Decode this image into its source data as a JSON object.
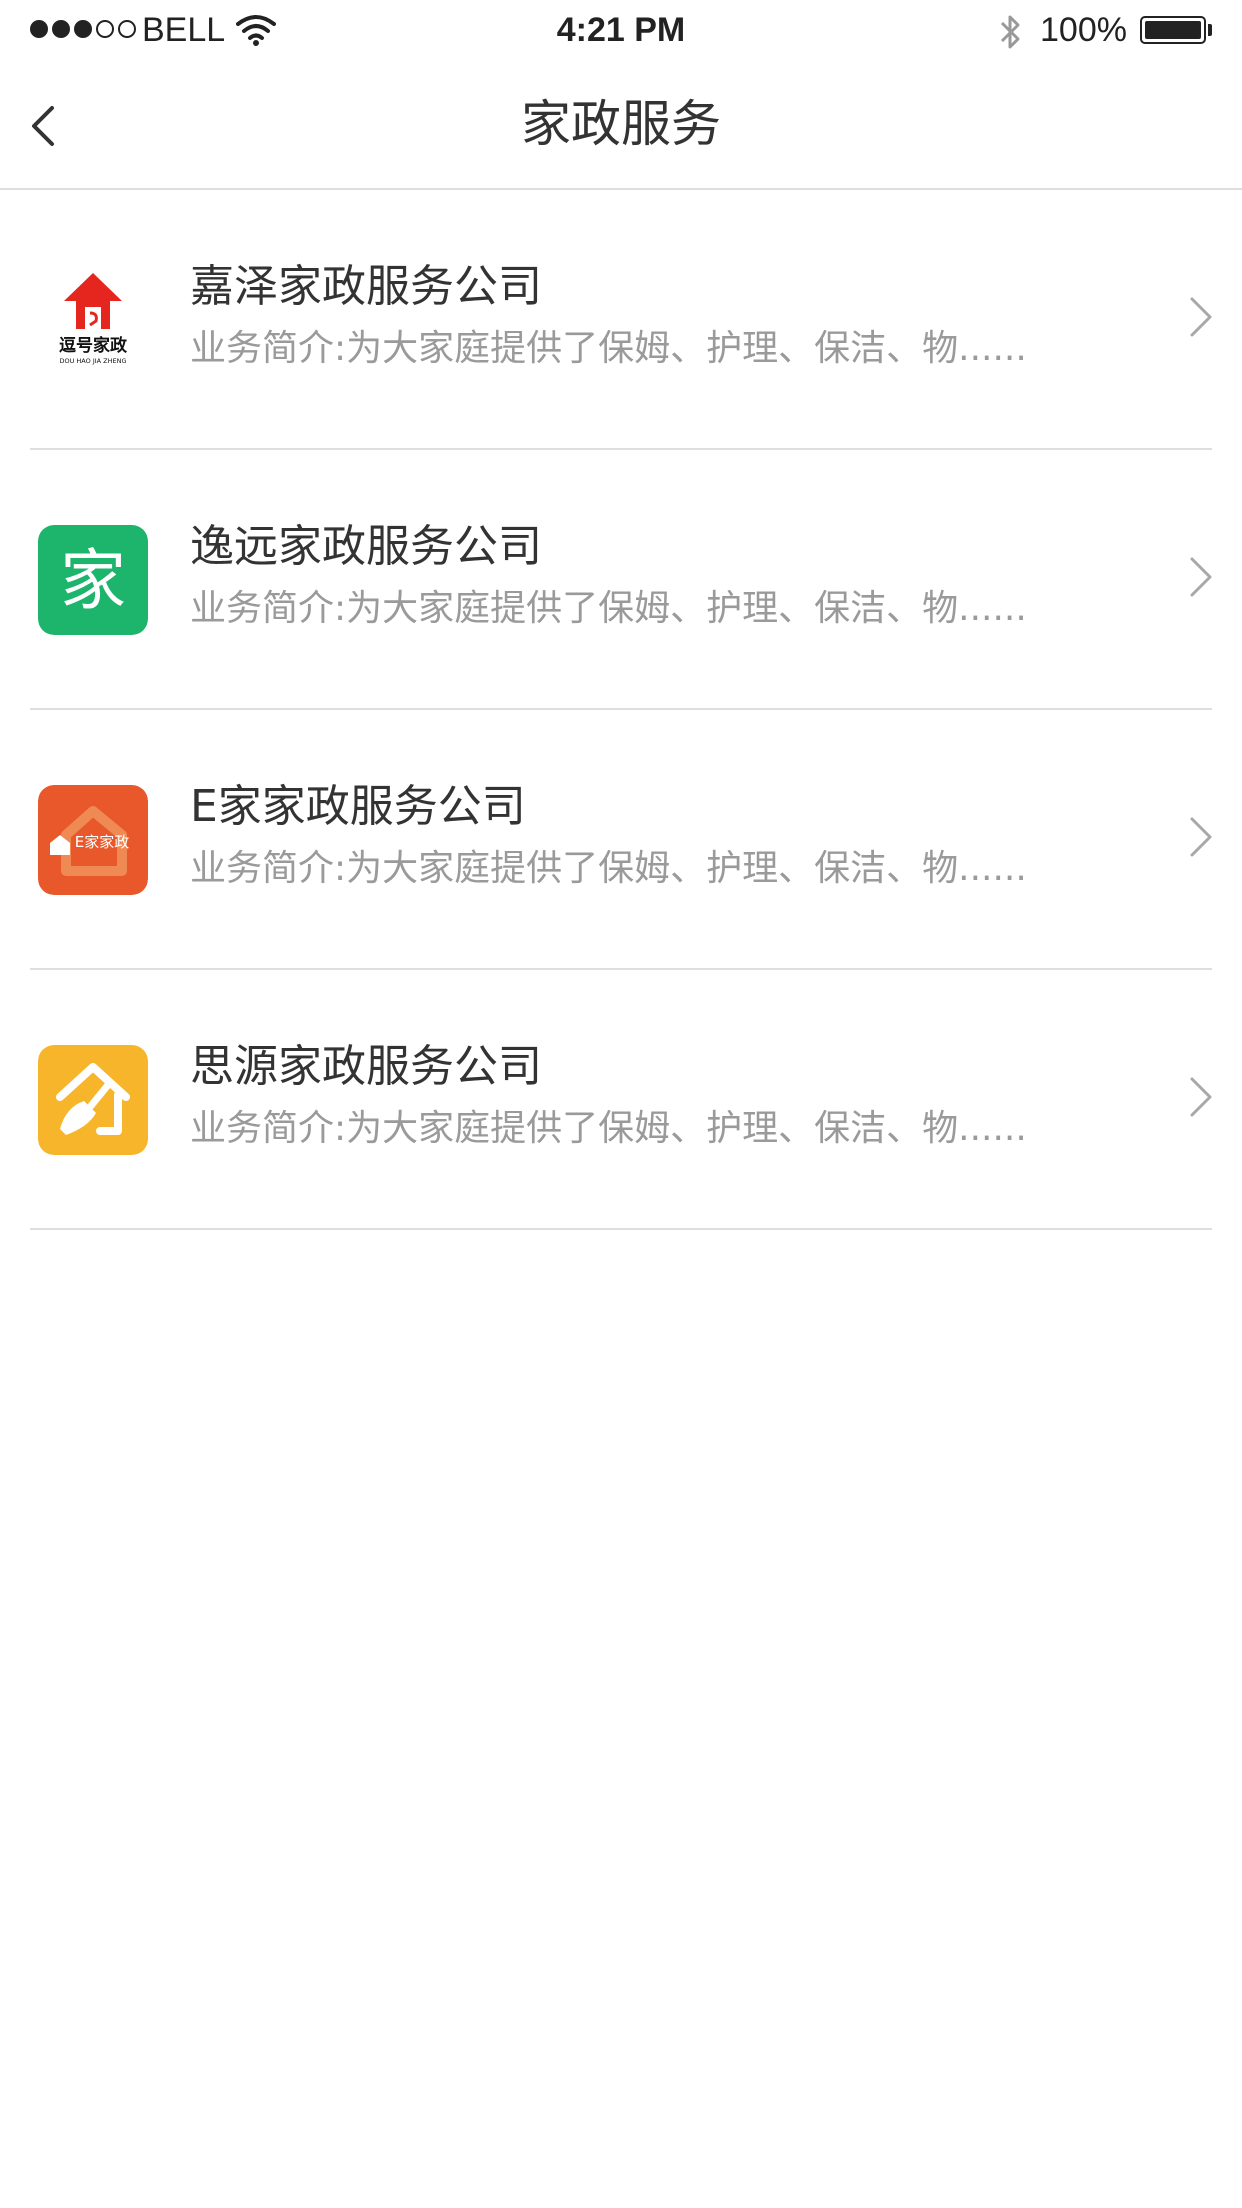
{
  "status_bar": {
    "carrier": "BELL",
    "signal": {
      "filled": 3,
      "total": 5
    },
    "time": "4:21 PM",
    "battery_percent": "100%",
    "icons": [
      "signal-dots-icon",
      "wifi-icon",
      "bluetooth-icon",
      "battery-icon"
    ]
  },
  "nav": {
    "title": "家政服务",
    "back_icon": "chevron-left-icon"
  },
  "companies": [
    {
      "name": "嘉泽家政服务公司",
      "description": "业务简介:为大家庭提供了保姆、护理、保洁、物......",
      "logo_icon": "house-logo-icon",
      "logo_text": "逗号家政",
      "logo_subtext": "DOU HAO JIA ZHENG",
      "logo_color": "#e5261f"
    },
    {
      "name": "逸远家政服务公司",
      "description": "业务简介:为大家庭提供了保姆、护理、保洁、物......",
      "logo_icon": "jia-character-logo-icon",
      "logo_text": "家",
      "logo_color": "#1db56b"
    },
    {
      "name": "E家家政服务公司",
      "description": "业务简介:为大家庭提供了保姆、护理、保洁、物......",
      "logo_icon": "e-home-logo-icon",
      "logo_text": "E家家政",
      "logo_color": "#e8582a"
    },
    {
      "name": "思源家政服务公司",
      "description": "业务简介:为大家庭提供了保姆、护理、保洁、物......",
      "logo_icon": "house-broom-logo-icon",
      "logo_color": "#f6b52a"
    }
  ],
  "colors": {
    "divider": "#dedede",
    "title_text": "#333333",
    "secondary_text": "#9a9a9a",
    "chevron": "#a8a8a8"
  }
}
